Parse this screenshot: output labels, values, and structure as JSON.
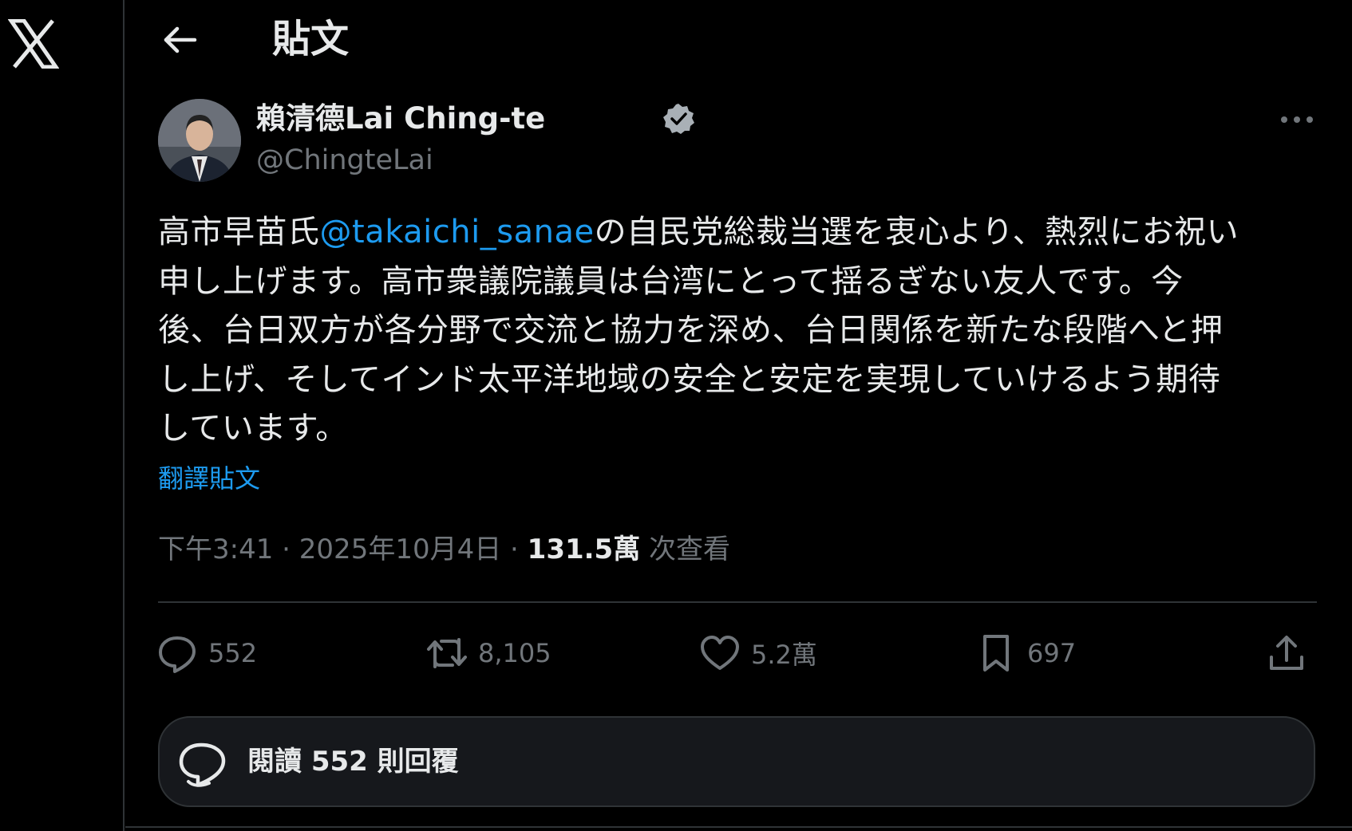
{
  "header": {
    "title": "貼文"
  },
  "tweet": {
    "author_name": "賴清德Lai Ching-te",
    "handle": "@ChingteLai",
    "text_before_mention": "高市早苗氏",
    "mention": "@takaichi_sanae",
    "text_after_mention": "の自民党総裁当選を衷心より、熱烈にお祝い\n申し上げます。高市衆議院議員は台湾にとって揺るぎない友人です。今\n後、台日双方が各分野で交流と協力を深め、台日関係を新たな段階へと押\nし上げ、そしてインド太平洋地域の安全と安定を実現していけるよう期待\nしています。",
    "translate_label": "翻譯貼文",
    "time": "下午3:41",
    "date": "2025年10月4日",
    "separator": "·",
    "views_count": "131.5萬",
    "views_label": "次查看"
  },
  "actions": {
    "reply_count": "552",
    "retweet_count": "8,105",
    "like_count": "5.2萬",
    "bookmark_count": "697"
  },
  "replies_button": {
    "label": "閱讀 552 則回覆"
  },
  "colors": {
    "background": "#000000",
    "text_primary": "#e7e9ea",
    "text_secondary": "#71767b",
    "accent": "#1d9bf0",
    "border": "#2f3336"
  },
  "icons": [
    "x-logo-icon",
    "back-arrow-icon",
    "verified-badge-icon",
    "more-icon",
    "reply-icon",
    "retweet-icon",
    "like-icon",
    "bookmark-icon",
    "share-icon",
    "chat-bubbles-icon"
  ]
}
